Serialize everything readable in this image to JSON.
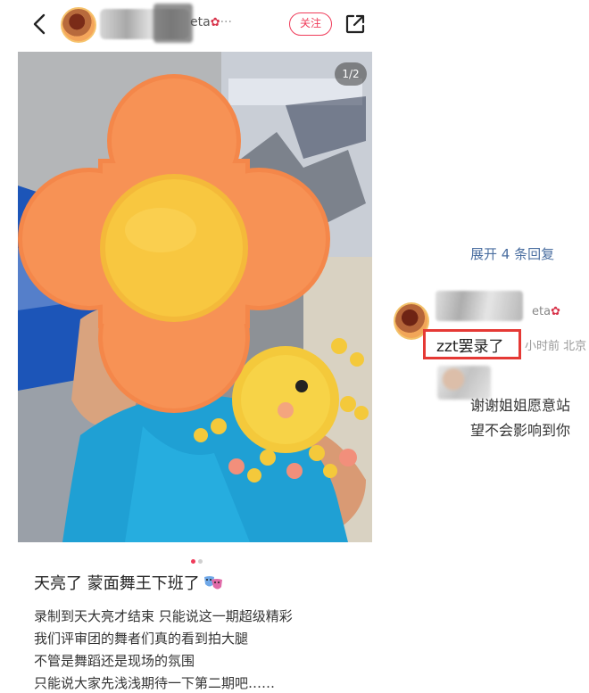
{
  "header": {
    "username_tail": "eta",
    "follow_label": "关注",
    "icons": {
      "back": "chevron-left-icon",
      "share": "share-out-icon",
      "username_flower": "rose-icon"
    }
  },
  "photo": {
    "counter": "1/2",
    "page_dots": {
      "active": 1,
      "total": 2,
      "active_color": "#ef3c5a",
      "inactive_color": "#cfcfcf"
    },
    "stickers": [
      "orange-flower-sticker",
      "sun-sticker"
    ]
  },
  "caption": {
    "title": "天亮了 蒙面舞王下班了",
    "title_emoji": "theater-masks-icon",
    "lines": [
      "录制到天大亮才结束 只能说这一期超级精彩",
      "我们评审团的舞者们真的看到拍大腿",
      "不管是舞蹈还是现场的氛围",
      "只能说大家先浅浅期待一下第二期吧……"
    ]
  },
  "comments": {
    "expand_label": "展开 4 条回复",
    "commenter_name_tail": "eta",
    "comment_text": "zzt罢录了",
    "comment_meta": "小时前  北京",
    "reply_line1": "谢谢姐姐愿意站",
    "reply_line2": "望不会影响到你",
    "highlight_color": "#e53935"
  },
  "colors": {
    "accent": "#ef3c5a",
    "link": "#4a6ea0"
  }
}
